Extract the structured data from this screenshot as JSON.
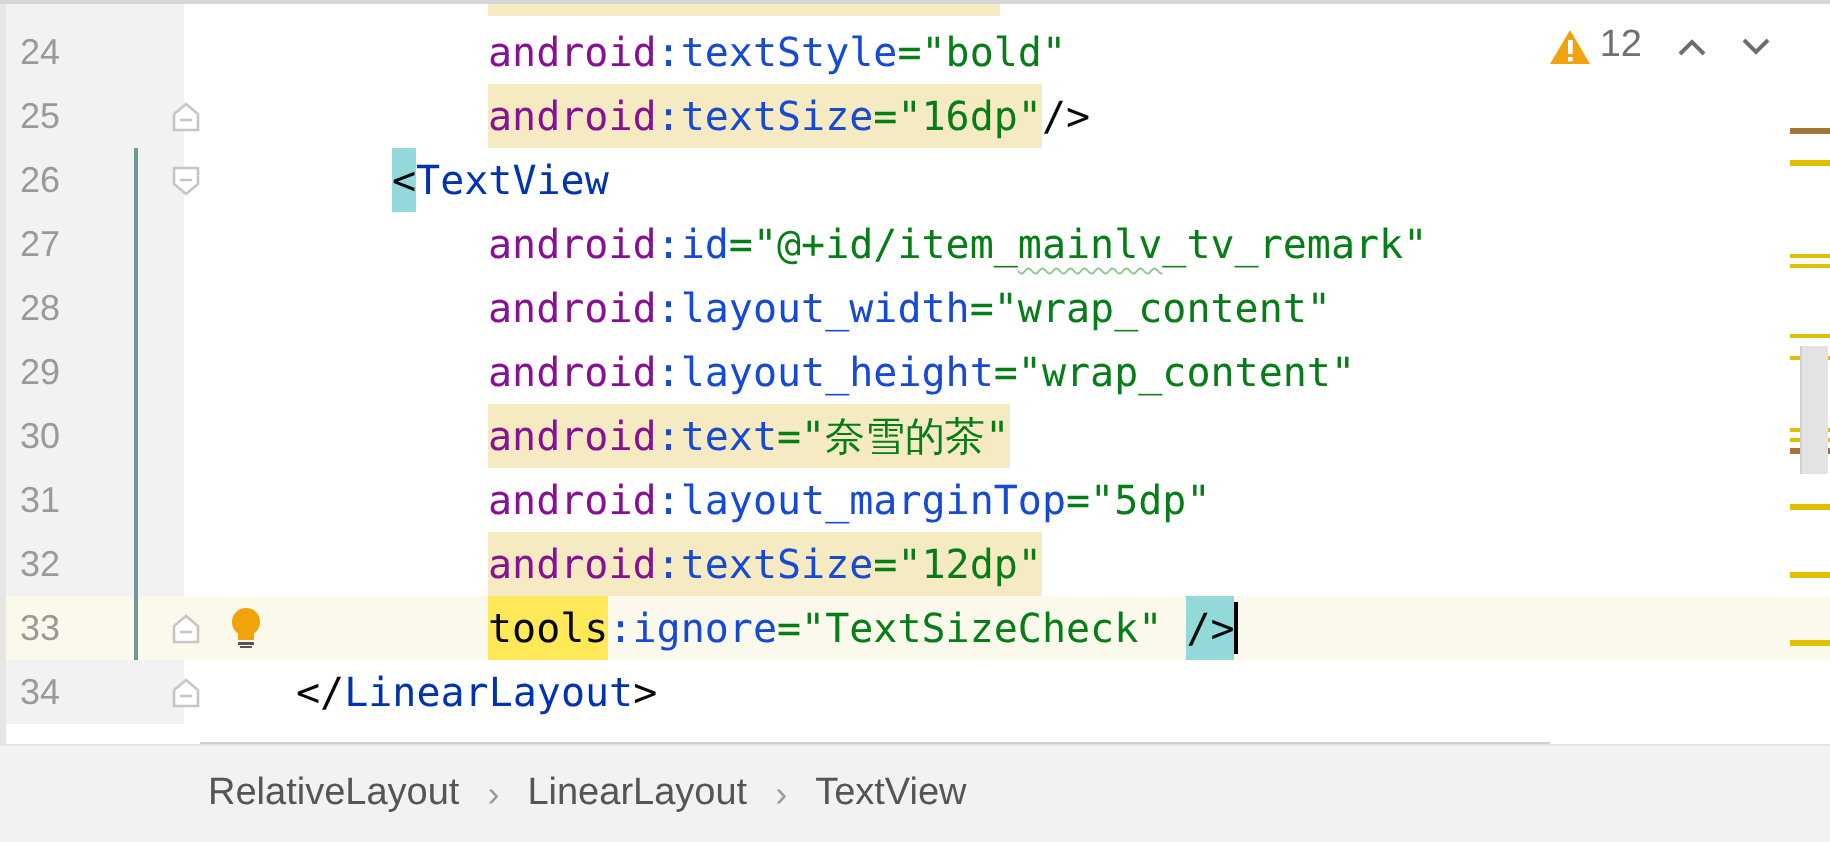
{
  "editor": {
    "lines": [
      {
        "number": "24",
        "kind": "attribute",
        "current": false,
        "changed": false,
        "bulb": false,
        "caret": false,
        "fold_start": false,
        "fold_end": false,
        "tokens": [
          {
            "text": "android",
            "kind": "ns"
          },
          {
            "text": ":textStyle",
            "kind": "attr"
          },
          {
            "text": "=\"bold\"",
            "kind": "str"
          }
        ]
      },
      {
        "number": "25",
        "kind": "attribute",
        "current": false,
        "changed": false,
        "bulb": false,
        "caret": false,
        "fold_start": false,
        "fold_end": true,
        "tokens": [
          {
            "text": "android",
            "kind": "ns",
            "occurrence_highlight": true
          },
          {
            "text": ":textSize",
            "kind": "attr",
            "occurrence_highlight": true
          },
          {
            "text": "=\"16dp\"",
            "kind": "str",
            "occurrence_highlight": true
          },
          {
            "text": "/>",
            "kind": "punct"
          }
        ]
      },
      {
        "number": "26",
        "kind": "element",
        "current": false,
        "changed": true,
        "bulb": false,
        "caret": false,
        "fold_start": true,
        "fold_end": false,
        "tokens": [
          {
            "text": "<",
            "kind": "punct",
            "brace_highlight": true
          },
          {
            "text": "TextView",
            "kind": "tag"
          }
        ]
      },
      {
        "number": "27",
        "kind": "attribute",
        "current": false,
        "changed": true,
        "bulb": false,
        "caret": false,
        "fold_start": false,
        "fold_end": false,
        "tokens": [
          {
            "text": "android",
            "kind": "ns"
          },
          {
            "text": ":id",
            "kind": "attr"
          },
          {
            "text": "=\"@+id/item_",
            "kind": "str"
          },
          {
            "text": "mainlv",
            "kind": "str",
            "typo": true
          },
          {
            "text": "_tv_remark\"",
            "kind": "str"
          }
        ]
      },
      {
        "number": "28",
        "kind": "attribute",
        "current": false,
        "changed": true,
        "bulb": false,
        "caret": false,
        "fold_start": false,
        "fold_end": false,
        "tokens": [
          {
            "text": "android",
            "kind": "ns"
          },
          {
            "text": ":layout_width",
            "kind": "attr"
          },
          {
            "text": "=\"wrap_content\"",
            "kind": "str"
          }
        ]
      },
      {
        "number": "29",
        "kind": "attribute",
        "current": false,
        "changed": true,
        "bulb": false,
        "caret": false,
        "fold_start": false,
        "fold_end": false,
        "tokens": [
          {
            "text": "android",
            "kind": "ns"
          },
          {
            "text": ":layout_height",
            "kind": "attr"
          },
          {
            "text": "=\"wrap_content\"",
            "kind": "str"
          }
        ]
      },
      {
        "number": "30",
        "kind": "attribute",
        "current": false,
        "changed": true,
        "bulb": false,
        "caret": false,
        "fold_start": false,
        "fold_end": false,
        "tokens": [
          {
            "text": "android",
            "kind": "ns",
            "occurrence_highlight": true
          },
          {
            "text": ":text",
            "kind": "attr",
            "occurrence_highlight": true
          },
          {
            "text": "=\"奈雪的茶\"",
            "kind": "str",
            "occurrence_highlight": true
          }
        ]
      },
      {
        "number": "31",
        "kind": "attribute",
        "current": false,
        "changed": true,
        "bulb": false,
        "caret": false,
        "fold_start": false,
        "fold_end": false,
        "tokens": [
          {
            "text": "android",
            "kind": "ns"
          },
          {
            "text": ":layout_marginTop",
            "kind": "attr"
          },
          {
            "text": "=\"5dp\"",
            "kind": "str"
          }
        ]
      },
      {
        "number": "32",
        "kind": "attribute",
        "current": false,
        "changed": true,
        "bulb": false,
        "caret": false,
        "fold_start": false,
        "fold_end": false,
        "tokens": [
          {
            "text": "android",
            "kind": "ns",
            "occurrence_highlight": true
          },
          {
            "text": ":textSize",
            "kind": "attr",
            "occurrence_highlight": true
          },
          {
            "text": "=\"12dp\"",
            "kind": "str",
            "occurrence_highlight": true
          }
        ]
      },
      {
        "number": "33",
        "kind": "attribute",
        "current": true,
        "changed": true,
        "bulb": true,
        "caret": true,
        "fold_start": false,
        "fold_end": true,
        "tokens": [
          {
            "text": "tools",
            "kind": "ns",
            "search_highlight": true
          },
          {
            "text": ":ignore",
            "kind": "attr"
          },
          {
            "text": "=\"TextSizeCheck\" ",
            "kind": "str"
          },
          {
            "text": "/>",
            "kind": "punct",
            "brace_highlight": true
          }
        ]
      },
      {
        "number": "34",
        "kind": "parent",
        "current": false,
        "changed": false,
        "bulb": false,
        "caret": false,
        "fold_start": false,
        "fold_end": true,
        "tokens": [
          {
            "text": "</",
            "kind": "punct"
          },
          {
            "text": "LinearLayout",
            "kind": "tag"
          },
          {
            "text": ">",
            "kind": "punct"
          }
        ]
      }
    ],
    "warnings": {
      "count": "12"
    }
  },
  "breadcrumbs": [
    {
      "kind": "crumb",
      "text": "RelativeLayout"
    },
    {
      "kind": "separator",
      "text": "›"
    },
    {
      "kind": "crumb",
      "text": "LinearLayout"
    },
    {
      "kind": "separator",
      "text": "›"
    },
    {
      "kind": "crumb",
      "text": "TextView"
    }
  ]
}
